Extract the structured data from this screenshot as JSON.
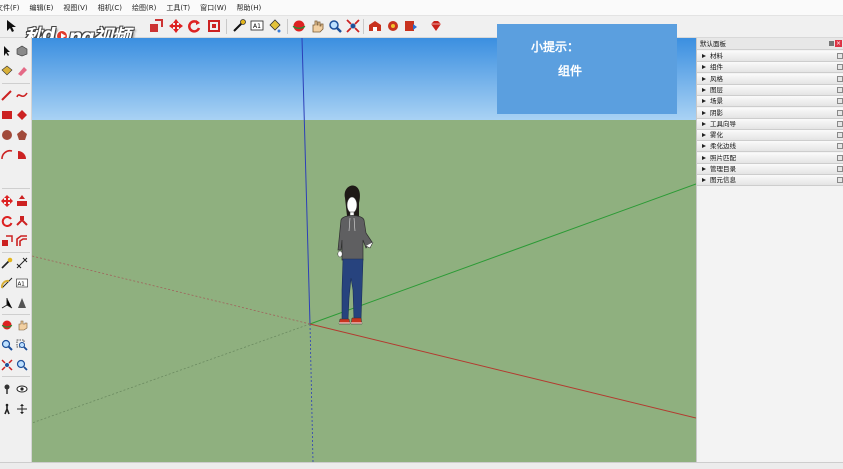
{
  "menu": [
    "文件(F)",
    "编辑(E)",
    "视图(V)",
    "相机(C)",
    "绘图(R)",
    "工具(T)",
    "窗口(W)",
    "帮助(H)"
  ],
  "watermark": "秒懂视频",
  "hint": {
    "title": "小提示：",
    "body": "组件"
  },
  "tray": {
    "title": "默认面板",
    "panels": [
      "材料",
      "组件",
      "风格",
      "图层",
      "场景",
      "阴影",
      "工具向导",
      "雾化",
      "柔化边线",
      "照片匹配",
      "管理目录",
      "图元信息"
    ]
  },
  "status": {
    "text": ""
  },
  "colors": {
    "sky_top": "#3b8fe0",
    "sky_bottom": "#a9d2f4",
    "ground": "#8fb07f",
    "hint_bg": "#5b9fdf",
    "axis_red": "#b33a2f",
    "axis_green": "#2b9a35",
    "axis_blue": "#2c3fb8"
  },
  "icons": {
    "top_toolbar": [
      "select-arrow-icon",
      "eraser-icon",
      "pencil-icon",
      "rectangle-icon",
      "circle-icon",
      "arc-icon",
      "pushpull-icon",
      "move-icon",
      "rotate-icon",
      "scale-icon",
      "tape-measure-icon",
      "text-icon",
      "paint-bucket-icon",
      "orbit-icon",
      "pan-icon",
      "zoom-icon",
      "zoom-extents-icon",
      "warehouse-icon",
      "share-model-icon",
      "extension-warehouse-icon",
      "send-layout-icon",
      "ruby-icon"
    ],
    "left_toolbar": [
      "select-arrow-icon",
      "component-icon",
      "paint-bucket-icon",
      "eraser-icon",
      "line-icon",
      "freehand-icon",
      "rectangle-icon",
      "rotated-rectangle-icon",
      "circle-icon",
      "polygon-icon",
      "arc-icon",
      "pie-icon",
      "move-icon",
      "pushpull-icon",
      "rotate-icon",
      "followme-icon",
      "scale-icon",
      "offset-icon",
      "tape-measure-icon",
      "dimension-icon",
      "protractor-icon",
      "text-icon",
      "axes-icon",
      "3d-text-icon",
      "orbit-icon",
      "pan-icon",
      "zoom-icon",
      "zoom-window-icon",
      "zoom-extents-icon",
      "previous-view-icon",
      "position-camera-icon",
      "walk-icon",
      "look-around-icon",
      "section-plane-icon"
    ]
  }
}
